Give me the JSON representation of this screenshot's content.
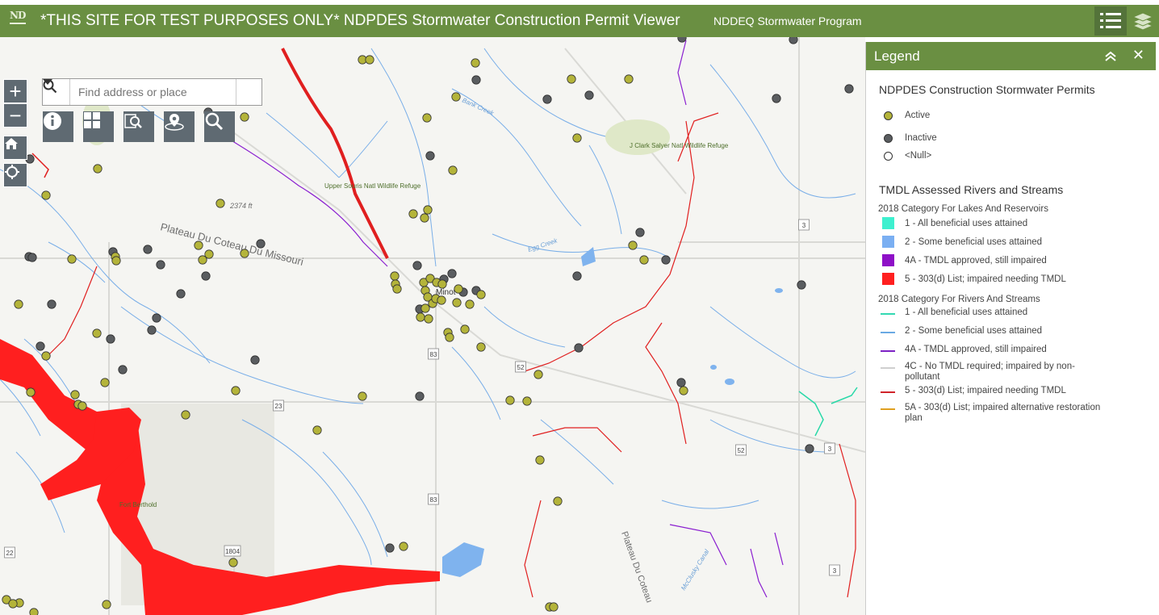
{
  "header": {
    "logo_text": "ND",
    "title": "*THIS SITE FOR TEST PURPOSES ONLY* NDPDES Stormwater Construction Permit Viewer",
    "subtitle": "NDDEQ Stormwater Program"
  },
  "colors": {
    "header_bg": "#6a8f42",
    "active": "#b4b43a",
    "inactive": "#5a5d60",
    "lake_cat1": "#3ef0cf",
    "lake_cat2": "#7aaff2",
    "lake_cat4a": "#8e10c7",
    "lake_cat5": "#ff1f1f",
    "river_cat1": "#33d9b2",
    "river_cat2": "#6aa9e3",
    "river_cat4a": "#7c22c4",
    "river_cat4c": "#cfcfcf",
    "river_cat5": "#d0232a",
    "river_cat5a": "#e0a020"
  },
  "search": {
    "placeholder": "Find address or place"
  },
  "icons": {
    "zoom_in": "plus-icon",
    "zoom_out": "minus-icon",
    "home": "home-icon",
    "locate": "locate-icon",
    "about": "info-icon",
    "basemap": "basemap-grid-icon",
    "query": "query-icon",
    "geolocate": "location-pin-icon",
    "search": "search-icon",
    "legend": "legend-list-icon",
    "layers": "layers-icon"
  },
  "map_labels": {
    "plateau1": "Plateau Du Coteau Du Missouri",
    "plateau2": "Plateau Du Coteau",
    "upper_souris": "Upper Souris Natl Wildlife Refuge",
    "clark_salyer": "J Clark Salyer Natl Wildlife Refuge",
    "elev_2374": "2374 ft",
    "creek_1": "Egg Creek",
    "creek_2": "Bank Creek",
    "canal": "McClusky Canal",
    "fort_berthold": "Fort Berthold",
    "minot": "Minot",
    "shields": [
      "52",
      "52",
      "83",
      "83",
      "23",
      "52",
      "3",
      "3",
      "3",
      "1804",
      "22"
    ]
  },
  "legend": {
    "title": "Legend",
    "layer1": {
      "title": "NDPDES Construction Stormwater Permits",
      "items": [
        "Active",
        "Inactive",
        "<Null>"
      ]
    },
    "layer2": {
      "title": "TMDL Assessed Rivers and Streams",
      "lakes_heading": "2018 Category For Lakes And Reservoirs",
      "lakes": [
        "1 - All beneficial uses attained",
        "2 - Some beneficial uses attained",
        "4A - TMDL approved, still impaired",
        "5 - 303(d) List; impaired needing TMDL"
      ],
      "rivers_heading": "2018 Category For Rivers And Streams",
      "rivers": [
        "1 - All beneficial uses attained",
        "2 - Some beneficial uses attained",
        "4A - TMDL approved, still impaired",
        "4C - No TMDL required; impaired by non-pollutant",
        "5 - 303(d) List; impaired needing TMDL",
        "5A - 303(d) List; impaired alternative restoration plan"
      ]
    }
  }
}
